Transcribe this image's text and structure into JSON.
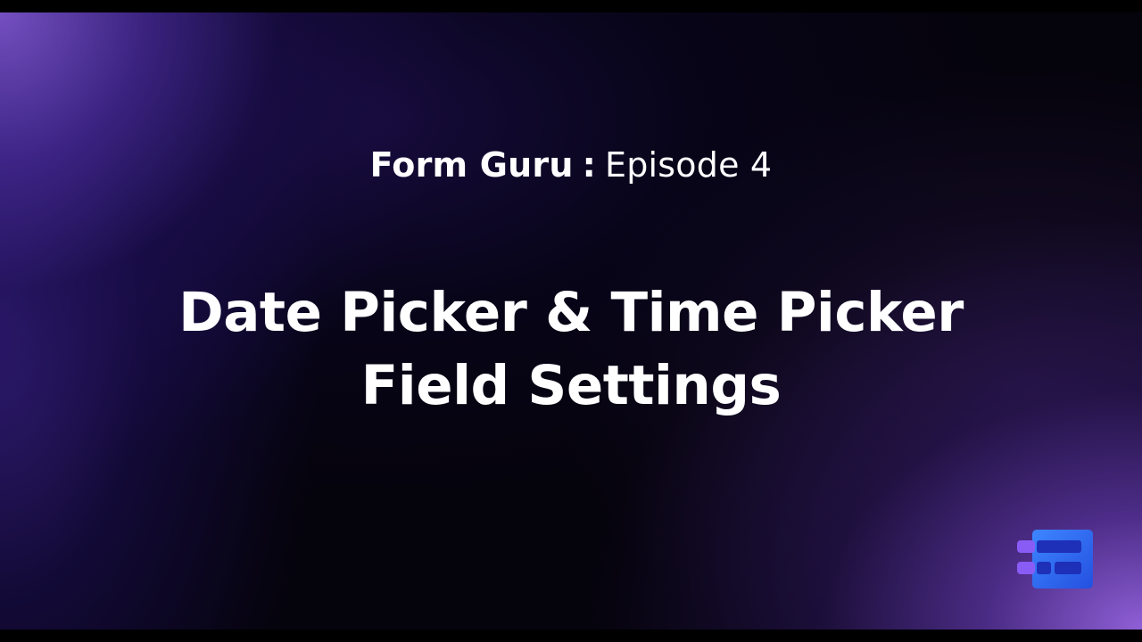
{
  "header": {
    "series_name": "Form Guru",
    "separator": ":",
    "episode_label": "Episode 4"
  },
  "title": {
    "line1": "Date Picker & Time Picker",
    "line2": "Field Settings"
  },
  "icons": {
    "logo": "form-builder-logo-icon"
  },
  "colors": {
    "text": "#ffffff",
    "logo_blue": "#2f6bf0",
    "logo_purple": "#8a5cf6",
    "accent_purple": "#9664e1"
  }
}
